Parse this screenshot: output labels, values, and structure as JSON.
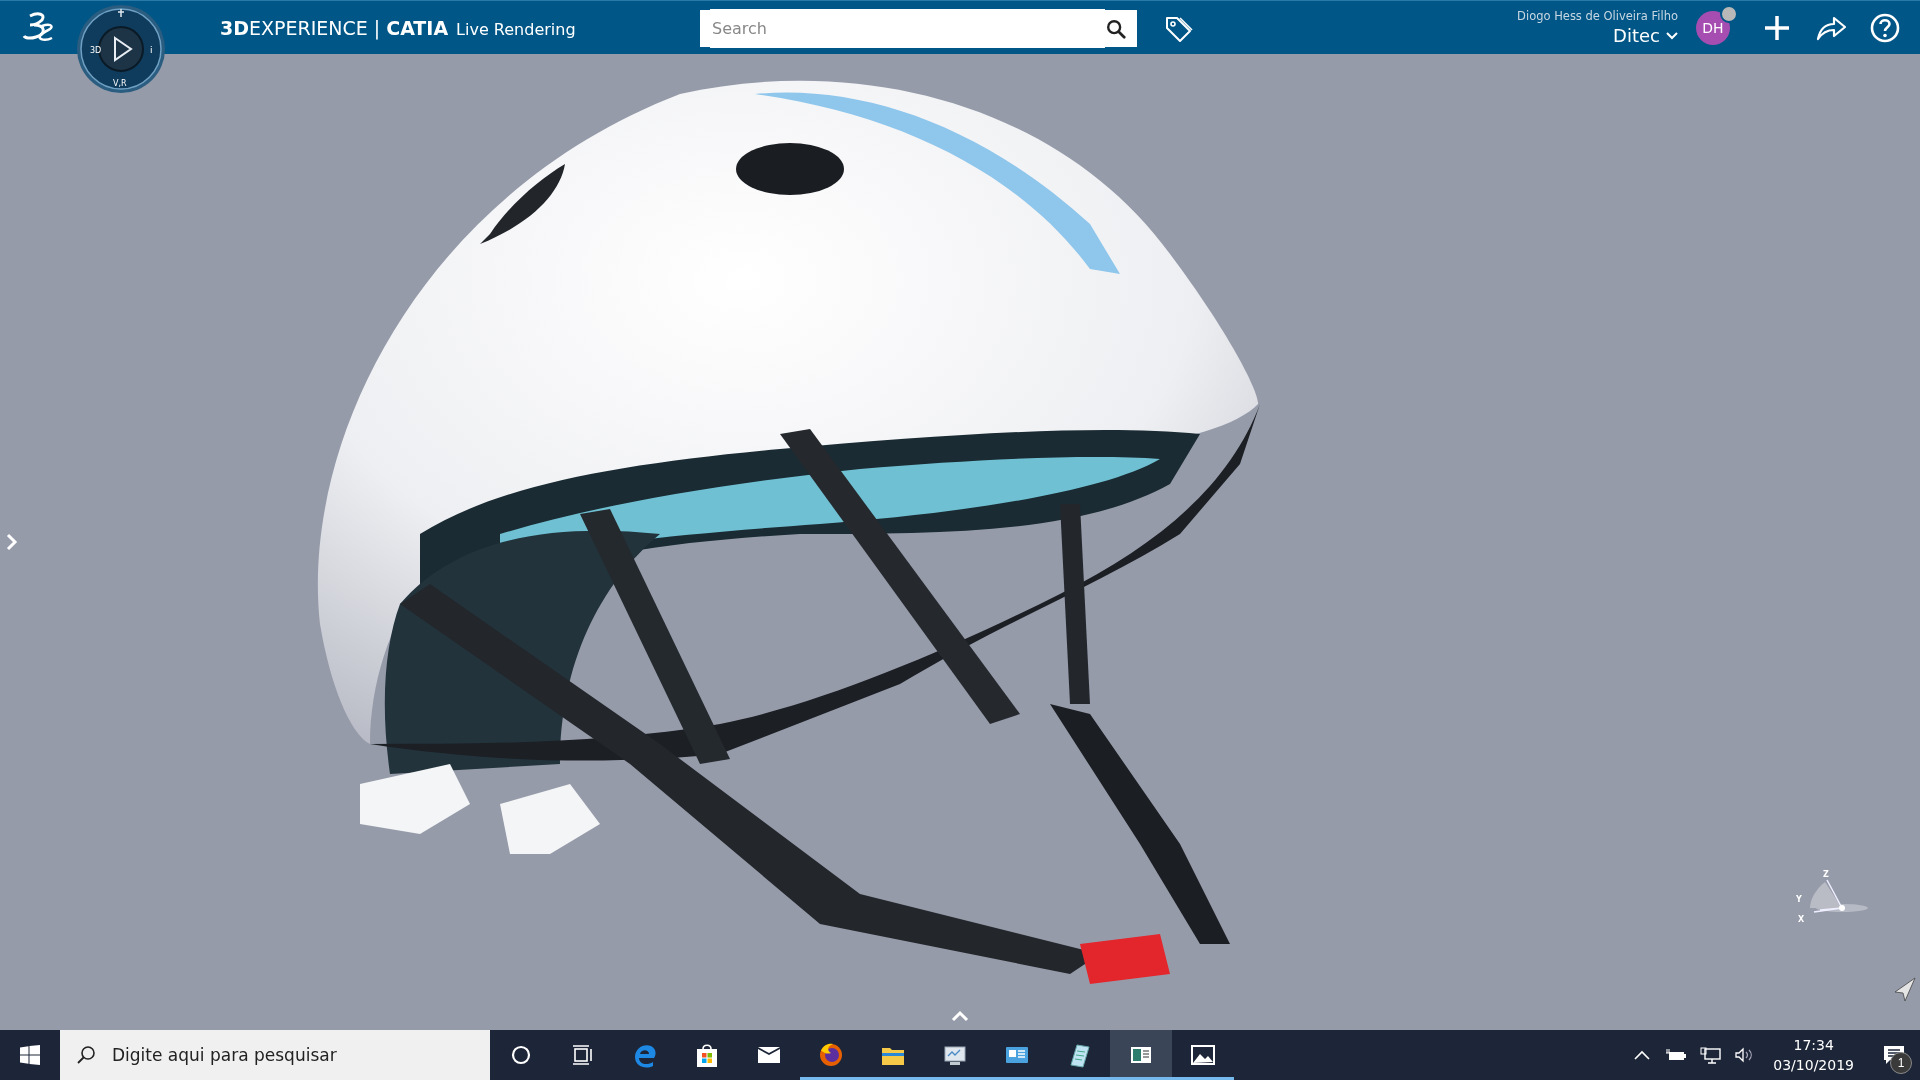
{
  "header": {
    "brand": {
      "prefix": "3D",
      "main": "EXPERIENCE",
      "separator": "|",
      "app": "CATIA",
      "module": "Live Rendering"
    },
    "compass": {
      "labels": [
        "3D",
        "V,R",
        "i"
      ]
    },
    "search": {
      "placeholder": "Search"
    },
    "user": {
      "name": "Diogo Hess de Oliveira Filho",
      "tenant": "Ditec",
      "initials": "DH"
    }
  },
  "viewport": {
    "triad_axes": [
      "Z",
      "Y",
      "X"
    ]
  },
  "taskbar": {
    "search": {
      "placeholder": "Digite aqui para pesquisar"
    },
    "apps": [
      {
        "kind": "cortana",
        "running": false,
        "selected": false
      },
      {
        "kind": "taskview",
        "running": false,
        "selected": false
      },
      {
        "kind": "edge",
        "running": false,
        "selected": false
      },
      {
        "kind": "store",
        "running": false,
        "selected": false
      },
      {
        "kind": "mail",
        "running": false,
        "selected": false
      },
      {
        "kind": "firefox",
        "running": true,
        "selected": false
      },
      {
        "kind": "explorer",
        "running": true,
        "selected": false
      },
      {
        "kind": "monitor",
        "running": true,
        "selected": false
      },
      {
        "kind": "card",
        "running": true,
        "selected": false
      },
      {
        "kind": "notepad",
        "running": true,
        "selected": false
      },
      {
        "kind": "window",
        "running": true,
        "selected": true
      },
      {
        "kind": "photos",
        "running": true,
        "selected": false
      }
    ],
    "time": "17:34",
    "date": "03/10/2019",
    "notifications": "1"
  }
}
